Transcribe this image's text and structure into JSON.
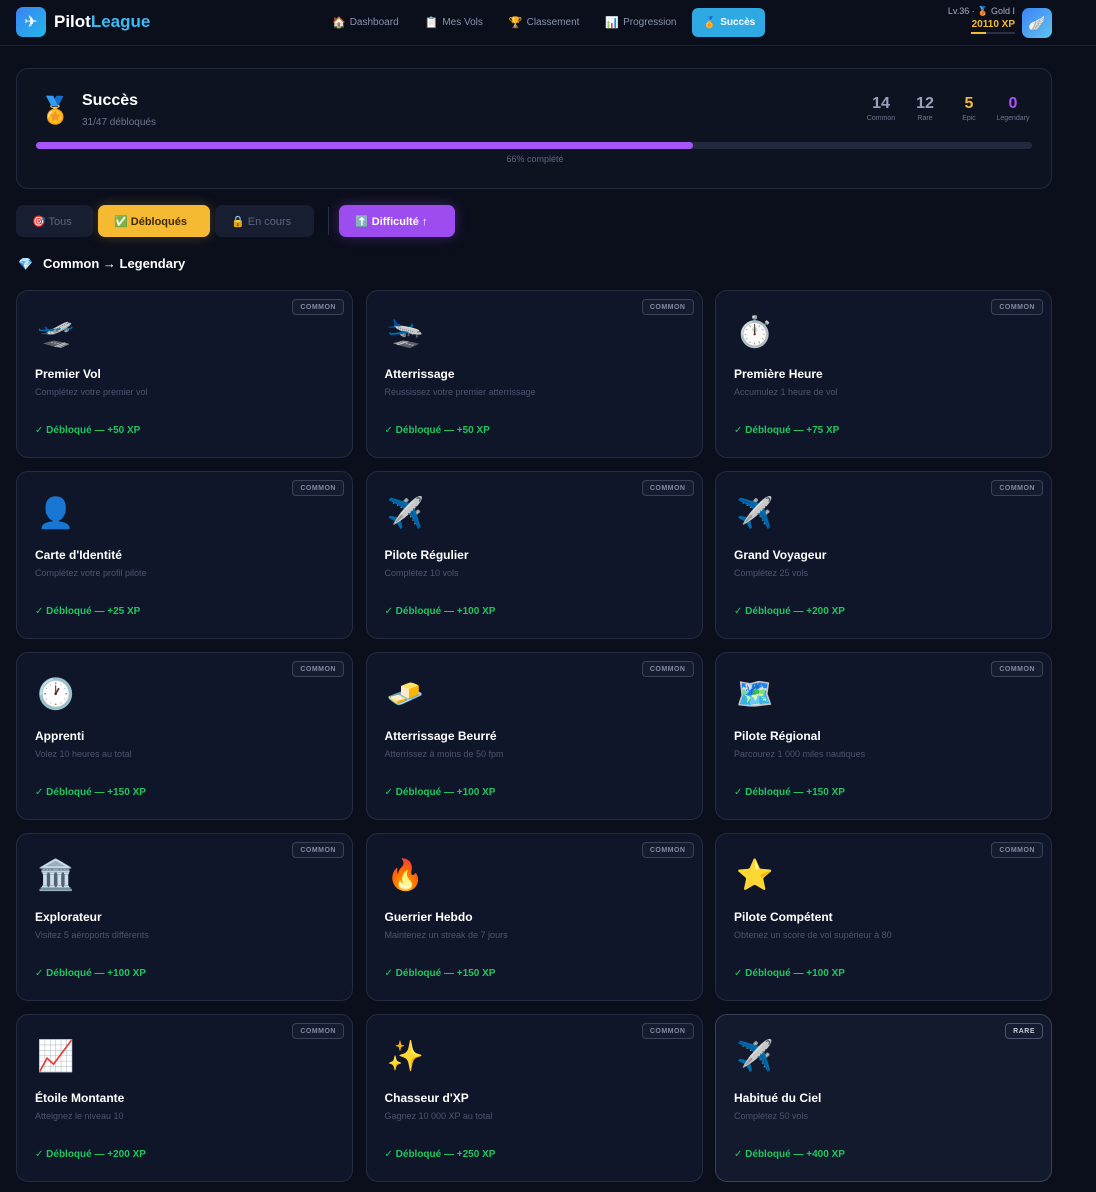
{
  "app": {
    "name_part1": "Pilot",
    "name_part2": "League",
    "logo_icon": "✈"
  },
  "nav": [
    {
      "icon": "🏠",
      "label": "Dashboard",
      "active": false
    },
    {
      "icon": "📋",
      "label": "Mes Vols",
      "active": false
    },
    {
      "icon": "🏆",
      "label": "Classement",
      "active": false
    },
    {
      "icon": "📊",
      "label": "Progression",
      "active": false
    },
    {
      "icon": "🏅",
      "label": "Succès",
      "active": true
    }
  ],
  "user": {
    "level": "Lv.36 · 🥉 Gold I",
    "xp": "20110 XP",
    "xp_progress": 0.35,
    "avatar_icon": "🪽"
  },
  "header": {
    "icon": "🏅",
    "title": "Succès",
    "subtitle": "31/47 débloqués",
    "progress": 0.66,
    "progress_label": "66% complété",
    "stats": [
      {
        "value": "14",
        "label": "Common",
        "color": "#9aa3b8"
      },
      {
        "value": "12",
        "label": "Rare",
        "color": "#9aa3b8"
      },
      {
        "value": "5",
        "label": "Epic",
        "color": "#f5b932"
      },
      {
        "value": "0",
        "label": "Legendary",
        "color": "#a855f7"
      }
    ]
  },
  "filters": {
    "all": "🎯 Tous",
    "unlocked": "✅ Débloqués",
    "in_progress": "🔒 En cours",
    "sort": "⬆️ Difficulté ↑"
  },
  "section": {
    "icon": "💎",
    "title": "Common → Legendary"
  },
  "achievements": [
    {
      "icon": "🛫",
      "title": "Premier Vol",
      "desc": "Complétez votre premier vol",
      "status": "✓ Débloqué — +50 XP",
      "rarity": "COMMON"
    },
    {
      "icon": "🛬",
      "title": "Atterrissage",
      "desc": "Réussissez votre premier atterrissage",
      "status": "✓ Débloqué — +50 XP",
      "rarity": "COMMON"
    },
    {
      "icon": "⏱️",
      "title": "Première Heure",
      "desc": "Accumulez 1 heure de vol",
      "status": "✓ Débloqué — +75 XP",
      "rarity": "COMMON"
    },
    {
      "icon": "👤",
      "title": "Carte d'Identité",
      "desc": "Complétez votre profil pilote",
      "status": "✓ Débloqué — +25 XP",
      "rarity": "COMMON"
    },
    {
      "icon": "✈️",
      "title": "Pilote Régulier",
      "desc": "Complétez 10 vols",
      "status": "✓ Débloqué — +100 XP",
      "rarity": "COMMON"
    },
    {
      "icon": "✈️",
      "title": "Grand Voyageur",
      "desc": "Complétez 25 vols",
      "status": "✓ Débloqué — +200 XP",
      "rarity": "COMMON"
    },
    {
      "icon": "🕐",
      "title": "Apprenti",
      "desc": "Volez 10 heures au total",
      "status": "✓ Débloqué — +150 XP",
      "rarity": "COMMON"
    },
    {
      "icon": "🧈",
      "title": "Atterrissage Beurré",
      "desc": "Atterrissez à moins de 50 fpm",
      "status": "✓ Débloqué — +100 XP",
      "rarity": "COMMON"
    },
    {
      "icon": "🗺️",
      "title": "Pilote Régional",
      "desc": "Parcourez 1 000 miles nautiques",
      "status": "✓ Débloqué — +150 XP",
      "rarity": "COMMON"
    },
    {
      "icon": "🏛️",
      "title": "Explorateur",
      "desc": "Visitez 5 aéroports différents",
      "status": "✓ Débloqué — +100 XP",
      "rarity": "COMMON"
    },
    {
      "icon": "🔥",
      "title": "Guerrier Hebdo",
      "desc": "Maintenez un streak de 7 jours",
      "status": "✓ Débloqué — +150 XP",
      "rarity": "COMMON"
    },
    {
      "icon": "⭐",
      "title": "Pilote Compétent",
      "desc": "Obtenez un score de vol supérieur à 80",
      "status": "✓ Débloqué — +100 XP",
      "rarity": "COMMON"
    },
    {
      "icon": "📈",
      "title": "Étoile Montante",
      "desc": "Atteignez le niveau 10",
      "status": "✓ Débloqué — +200 XP",
      "rarity": "COMMON"
    },
    {
      "icon": "✨",
      "title": "Chasseur d'XP",
      "desc": "Gagnez 10 000 XP au total",
      "status": "✓ Débloqué — +250 XP",
      "rarity": "COMMON"
    },
    {
      "icon": "✈️",
      "title": "Habitué du Ciel",
      "desc": "Complétez 50 vols",
      "status": "✓ Débloqué — +400 XP",
      "rarity": "RARE"
    }
  ]
}
